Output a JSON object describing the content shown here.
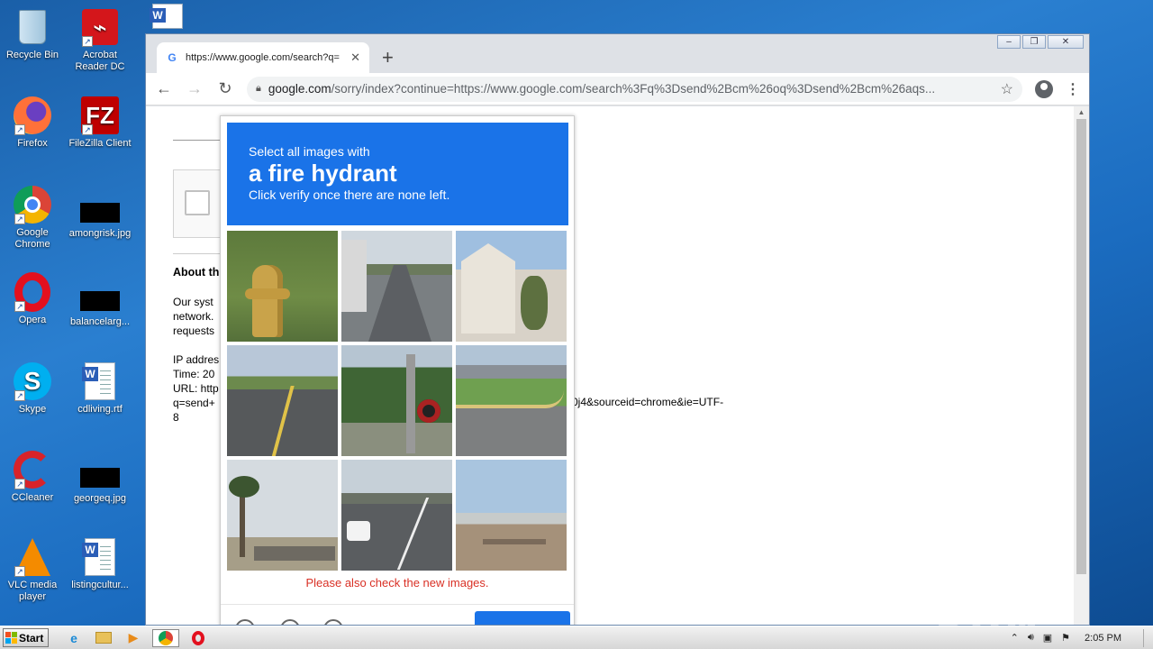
{
  "desktop": {
    "icons": [
      {
        "label": "Recycle Bin",
        "icon": "recycle-bin-icon"
      },
      {
        "label": "Acrobat Reader DC",
        "icon": "acrobat-icon"
      },
      {
        "label": "Firefox",
        "icon": "firefox-icon"
      },
      {
        "label": "FileZilla Client",
        "icon": "filezilla-icon"
      },
      {
        "label": "Google Chrome",
        "icon": "chrome-icon"
      },
      {
        "label": "amongrisk.jpg",
        "icon": "image-file-icon"
      },
      {
        "label": "Opera",
        "icon": "opera-icon"
      },
      {
        "label": "balancelarg...",
        "icon": "image-file-icon"
      },
      {
        "label": "Skype",
        "icon": "skype-icon"
      },
      {
        "label": "cdliving.rtf",
        "icon": "word-doc-icon"
      },
      {
        "label": "CCleaner",
        "icon": "ccleaner-icon"
      },
      {
        "label": "georgeq.jpg",
        "icon": "image-file-icon"
      },
      {
        "label": "VLC media player",
        "icon": "vlc-icon"
      },
      {
        "label": "listingcultur...",
        "icon": "word-doc-icon"
      }
    ]
  },
  "browser": {
    "tab_title": "https://www.google.com/search?q=",
    "tab_close": "✕",
    "new_tab": "+",
    "window_controls": {
      "minimize": "–",
      "restore": "❐",
      "close": "✕"
    },
    "url_host": "google.com",
    "url_path": "/sorry/index?continue=https://www.google.com/search%3Fq%3Dsend%2Bcm%26oq%3Dsend%2Bcm%26aqs..."
  },
  "sorry_page": {
    "about": "About th",
    "text": [
      "Our syst",
      "network.",
      "requests"
    ],
    "ip": [
      "IP addres",
      "Time: 20",
      "URL: http",
      "q=send+",
      "8"
    ],
    "url_tail": "0j4&sourceid=chrome&ie=UTF-"
  },
  "captcha": {
    "line1": "Select all images with",
    "target": "a fire hydrant",
    "line3": "Click verify once there are none left.",
    "notice": "Please also check the new images.",
    "accent": "#1a73e8"
  },
  "watermark": "ANY RUN",
  "taskbar": {
    "start": "Start",
    "clock": "2:05 PM",
    "pinned": [
      "internet-explorer-icon",
      "explorer-folder-icon",
      "media-player-icon",
      "chrome-icon",
      "opera-icon"
    ]
  }
}
